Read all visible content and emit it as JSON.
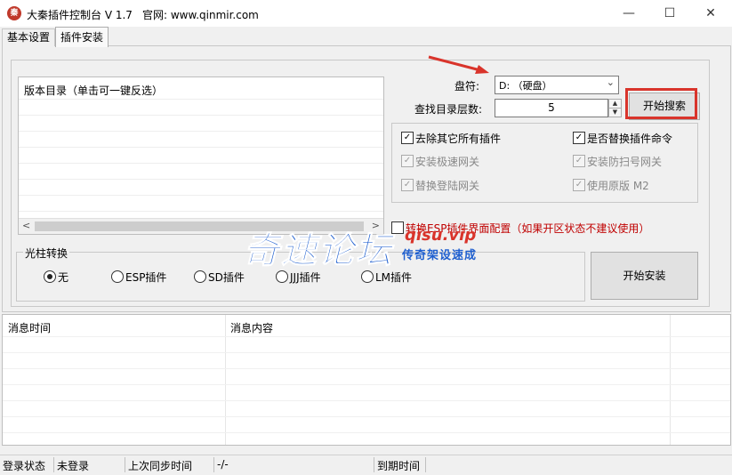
{
  "window": {
    "title": "大秦插件控制台 V 1.7",
    "site": "官网: www.qinmir.com",
    "minimize": "—",
    "maximize": "☐",
    "close": "✕"
  },
  "tabs": [
    {
      "label": "基本设置",
      "active": false
    },
    {
      "label": "插件安装",
      "active": true
    }
  ],
  "version_list": {
    "header": "版本目录（单击可一键反选）"
  },
  "drive": {
    "label": "盘符:",
    "value": "D: （硬盘）"
  },
  "depth": {
    "label": "查找目录层数:",
    "value": "5"
  },
  "search_button": "开始搜索",
  "options": [
    {
      "label": "去除其它所有插件",
      "checked": true,
      "enabled": true
    },
    {
      "label": "是否替换插件命令",
      "checked": true,
      "enabled": true
    },
    {
      "label": "安装极速网关",
      "checked": true,
      "enabled": false
    },
    {
      "label": "安装防扫号网关",
      "checked": true,
      "enabled": false
    },
    {
      "label": "替换登陆网关",
      "checked": true,
      "enabled": false
    },
    {
      "label": "使用原版 M2",
      "checked": true,
      "enabled": false
    }
  ],
  "convert": {
    "label": "转换ESP插件界面配置（如果开区状态不建议使用）",
    "checked": false
  },
  "pillar": {
    "title": "光柱转换",
    "options": [
      {
        "label": "无",
        "selected": true
      },
      {
        "label": "ESP插件",
        "selected": false
      },
      {
        "label": "SD插件",
        "selected": false
      },
      {
        "label": "JJJ插件",
        "selected": false
      },
      {
        "label": "LM插件",
        "selected": false
      }
    ]
  },
  "install_button": "开始安装",
  "log": {
    "columns": [
      "消息时间",
      "消息内容"
    ]
  },
  "status": {
    "login_label": "登录状态",
    "login_value": "未登录",
    "sync_label": "上次同步时间",
    "sync_value": "-/-",
    "expire_label": "到期时间"
  },
  "watermark": {
    "main": "奇速论坛",
    "site": "qisu.vip",
    "sub": "传奇架设速成"
  },
  "colors": {
    "highlight": "#d9342b",
    "watermark_blue": "#1f5fcf"
  },
  "icons": {
    "app": "dragon-logo-icon",
    "dropdown": "chevron-down-icon"
  }
}
